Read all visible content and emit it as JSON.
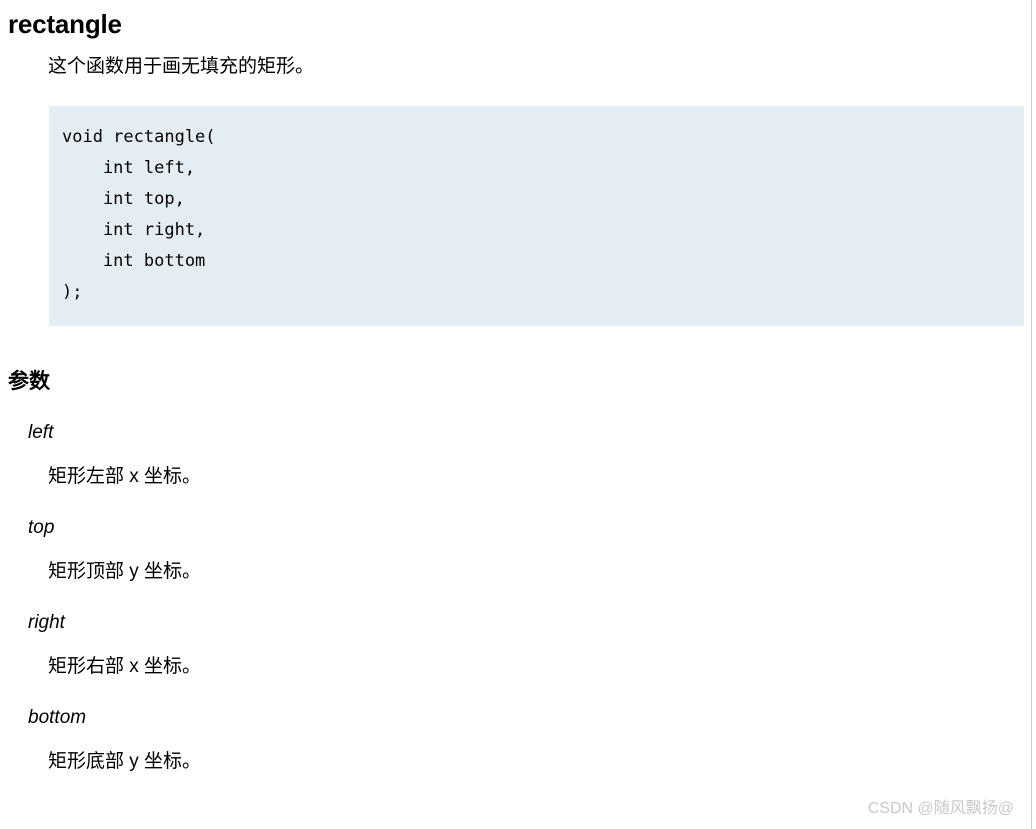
{
  "document": {
    "title": "rectangle",
    "intro": "这个函数用于画无填充的矩形。",
    "code": "void rectangle(\n    int left,\n    int top,\n    int right,\n    int bottom\n);",
    "code_background_color": "#e4ecf4",
    "parameters_heading": "参数",
    "parameters": [
      {
        "term": "left",
        "desc": "矩形左部 x 坐标。"
      },
      {
        "term": "top",
        "desc": "矩形顶部 y 坐标。"
      },
      {
        "term": "right",
        "desc": "矩形右部 x 坐标。"
      },
      {
        "term": "bottom",
        "desc": "矩形底部 y 坐标。"
      }
    ]
  },
  "watermark": {
    "text": "CSDN @随风飘扬@",
    "color": "#c9c9c9"
  }
}
